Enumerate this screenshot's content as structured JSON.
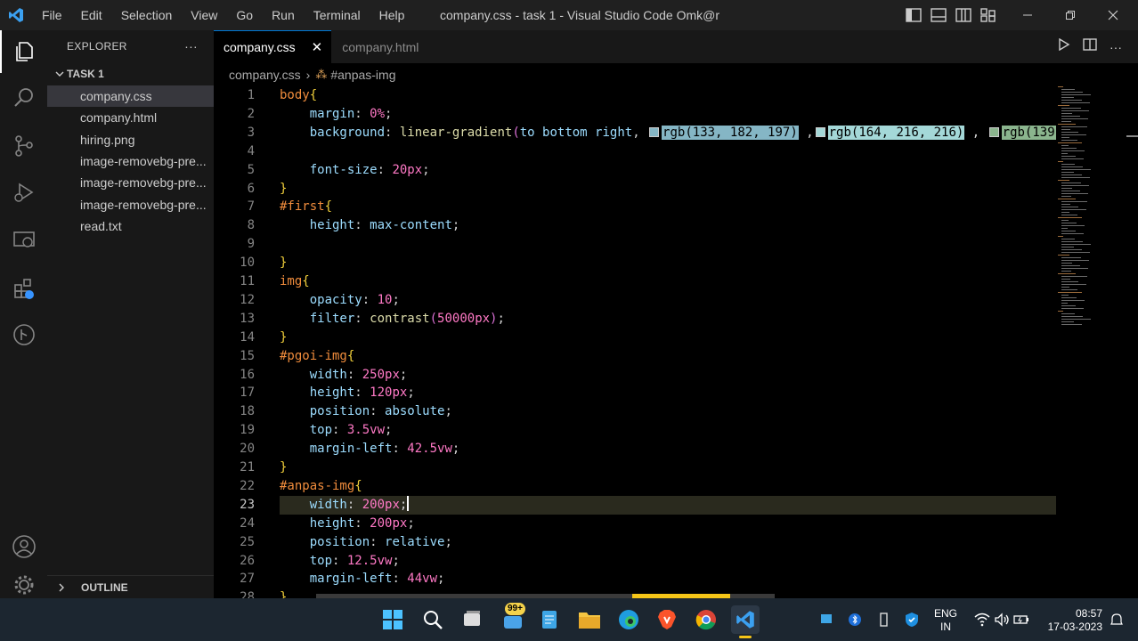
{
  "titlebar": {
    "menu": [
      "File",
      "Edit",
      "Selection",
      "View",
      "Go",
      "Run",
      "Terminal",
      "Help"
    ],
    "title": "company.css - task 1 - Visual Studio Code Omk@r"
  },
  "sidebar": {
    "header": "EXPLORER",
    "more": "···",
    "folder": "TASK 1",
    "files": [
      "company.css",
      "company.html",
      "hiring.png",
      "image-removebg-pre...",
      "image-removebg-pre...",
      "image-removebg-pre...",
      "read.txt"
    ],
    "outline": "OUTLINE"
  },
  "tabs": [
    {
      "label": "company.css",
      "active": true
    },
    {
      "label": "company.html",
      "active": false
    }
  ],
  "breadcrumb": {
    "file": "company.css",
    "symbol": "#anpas-img"
  },
  "editor": {
    "current_line": 23,
    "lines": [
      {
        "n": "1",
        "tokens": [
          [
            "sel",
            "body"
          ],
          [
            "br",
            "{"
          ]
        ]
      },
      {
        "n": "2",
        "tokens": [
          [
            "ind",
            "    "
          ],
          [
            "prop",
            "margin"
          ],
          [
            "punc",
            ": "
          ],
          [
            "num",
            "0"
          ],
          [
            "unit",
            "%"
          ],
          [
            "punc",
            ";"
          ]
        ]
      },
      {
        "n": "3",
        "tokens": [
          [
            "ind",
            "    "
          ],
          [
            "prop",
            "background"
          ],
          [
            "punc",
            ": "
          ],
          [
            "func",
            "linear-gradient"
          ],
          [
            "paren",
            "("
          ],
          [
            "val",
            "to bottom right"
          ],
          [
            "punc",
            ", "
          ]
        ]
      },
      {
        "n": "4",
        "tokens": []
      },
      {
        "n": "5",
        "tokens": [
          [
            "ind",
            "    "
          ],
          [
            "prop",
            "font-size"
          ],
          [
            "punc",
            ": "
          ],
          [
            "num",
            "20"
          ],
          [
            "unit",
            "px"
          ],
          [
            "punc",
            ";"
          ]
        ]
      },
      {
        "n": "6",
        "tokens": [
          [
            "br",
            "}"
          ]
        ]
      },
      {
        "n": "7",
        "tokens": [
          [
            "sel",
            "#first"
          ],
          [
            "br",
            "{"
          ]
        ]
      },
      {
        "n": "8",
        "tokens": [
          [
            "ind",
            "    "
          ],
          [
            "prop",
            "height"
          ],
          [
            "punc",
            ": "
          ],
          [
            "val",
            "max-content"
          ],
          [
            "punc",
            ";"
          ]
        ]
      },
      {
        "n": "9",
        "tokens": []
      },
      {
        "n": "10",
        "tokens": [
          [
            "br",
            "}"
          ]
        ]
      },
      {
        "n": "11",
        "tokens": [
          [
            "sel",
            "img"
          ],
          [
            "br",
            "{"
          ]
        ]
      },
      {
        "n": "12",
        "tokens": [
          [
            "ind",
            "    "
          ],
          [
            "prop",
            "opacity"
          ],
          [
            "punc",
            ": "
          ],
          [
            "num",
            "10"
          ],
          [
            "punc",
            ";"
          ]
        ]
      },
      {
        "n": "13",
        "tokens": [
          [
            "ind",
            "    "
          ],
          [
            "prop",
            "filter"
          ],
          [
            "punc",
            ": "
          ],
          [
            "func",
            "contrast"
          ],
          [
            "paren",
            "("
          ],
          [
            "num",
            "50000"
          ],
          [
            "unit",
            "px"
          ],
          [
            "paren",
            ")"
          ],
          [
            "punc",
            ";"
          ]
        ]
      },
      {
        "n": "14",
        "tokens": [
          [
            "br",
            "}"
          ]
        ]
      },
      {
        "n": "15",
        "tokens": [
          [
            "sel",
            "#pgoi-img"
          ],
          [
            "br",
            "{"
          ]
        ]
      },
      {
        "n": "16",
        "tokens": [
          [
            "ind",
            "    "
          ],
          [
            "prop",
            "width"
          ],
          [
            "punc",
            ": "
          ],
          [
            "num",
            "250"
          ],
          [
            "unit",
            "px"
          ],
          [
            "punc",
            ";"
          ]
        ]
      },
      {
        "n": "17",
        "tokens": [
          [
            "ind",
            "    "
          ],
          [
            "prop",
            "height"
          ],
          [
            "punc",
            ": "
          ],
          [
            "num",
            "120"
          ],
          [
            "unit",
            "px"
          ],
          [
            "punc",
            ";"
          ]
        ]
      },
      {
        "n": "18",
        "tokens": [
          [
            "ind",
            "    "
          ],
          [
            "prop",
            "position"
          ],
          [
            "punc",
            ": "
          ],
          [
            "val",
            "absolute"
          ],
          [
            "punc",
            ";"
          ]
        ]
      },
      {
        "n": "19",
        "tokens": [
          [
            "ind",
            "    "
          ],
          [
            "prop",
            "top"
          ],
          [
            "punc",
            ": "
          ],
          [
            "num",
            "3.5"
          ],
          [
            "unit",
            "vw"
          ],
          [
            "punc",
            ";"
          ]
        ]
      },
      {
        "n": "20",
        "tokens": [
          [
            "ind",
            "    "
          ],
          [
            "prop",
            "margin-left"
          ],
          [
            "punc",
            ": "
          ],
          [
            "num",
            "42.5"
          ],
          [
            "unit",
            "vw"
          ],
          [
            "punc",
            ";"
          ]
        ]
      },
      {
        "n": "21",
        "tokens": [
          [
            "br",
            "}"
          ]
        ]
      },
      {
        "n": "22",
        "tokens": [
          [
            "sel",
            "#anpas-img"
          ],
          [
            "br",
            "{"
          ]
        ]
      },
      {
        "n": "23",
        "tokens": [
          [
            "ind",
            "    "
          ],
          [
            "prop",
            "width"
          ],
          [
            "punc",
            ": "
          ],
          [
            "num",
            "200"
          ],
          [
            "unit",
            "px"
          ],
          [
            "punc",
            ";"
          ],
          [
            "cursor",
            ""
          ]
        ]
      },
      {
        "n": "24",
        "tokens": [
          [
            "ind",
            "    "
          ],
          [
            "prop",
            "height"
          ],
          [
            "punc",
            ": "
          ],
          [
            "num",
            "200"
          ],
          [
            "unit",
            "px"
          ],
          [
            "punc",
            ";"
          ]
        ]
      },
      {
        "n": "25",
        "tokens": [
          [
            "ind",
            "    "
          ],
          [
            "prop",
            "position"
          ],
          [
            "punc",
            ": "
          ],
          [
            "val",
            "relative"
          ],
          [
            "punc",
            ";"
          ]
        ]
      },
      {
        "n": "26",
        "tokens": [
          [
            "ind",
            "    "
          ],
          [
            "prop",
            "top"
          ],
          [
            "punc",
            ": "
          ],
          [
            "num",
            "12.5"
          ],
          [
            "unit",
            "vw"
          ],
          [
            "punc",
            ";"
          ]
        ]
      },
      {
        "n": "27",
        "tokens": [
          [
            "ind",
            "    "
          ],
          [
            "prop",
            "margin-left"
          ],
          [
            "punc",
            ": "
          ],
          [
            "num",
            "44"
          ],
          [
            "unit",
            "vw"
          ],
          [
            "punc",
            ";"
          ]
        ]
      },
      {
        "n": "28",
        "tokens": [
          [
            "br",
            "}"
          ]
        ]
      }
    ],
    "colors_line3": [
      {
        "text": "rgb(133, 182, 197)",
        "color": "#85b6c5",
        "sep": " ,"
      },
      {
        "text": "rgb(164, 216, 216)",
        "color": "#a4d8d8",
        "sep": " , "
      },
      {
        "text": "rgb(139",
        "color": "#8bb58e",
        "sep": ""
      }
    ]
  },
  "taskbar": {
    "badge": "99+",
    "lang": "ENG",
    "region": "IN",
    "time": "08:57",
    "date": "17-03-2023"
  }
}
